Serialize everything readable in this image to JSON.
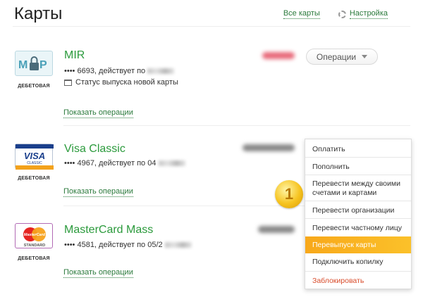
{
  "header": {
    "title": "Карты",
    "all_cards_link": "Все карты",
    "settings_link": "Настройка"
  },
  "cards": [
    {
      "name": "MIR",
      "type_label": "ДЕБЕТОВАЯ",
      "number_line": "•••• 6693, действует по",
      "status": "Статус выпуска новой карты",
      "show_ops": "Показать операции",
      "logo_text": "MIR",
      "amount_color": "#e86a7a"
    },
    {
      "name": "Visa Classic",
      "type_label": "ДЕБЕТОВАЯ",
      "number_line": "•••• 4967, действует по 04",
      "show_ops": "Показать операции",
      "logo_text": "VISA",
      "logo_subtext": "CLASSIC",
      "amount_color": "#777777"
    },
    {
      "name": "MasterCard Mass",
      "type_label": "ДЕБЕТОВАЯ",
      "number_line": "•••• 4581, действует по 05/2",
      "show_ops": "Показать операции",
      "logo_text": "MasterCard",
      "logo_subtext": "STANDARD",
      "amount_color": "#777777"
    }
  ],
  "operations_button": "Операции",
  "coin_label": "1",
  "dropdown": {
    "items": [
      "Оплатить",
      "Пополнить",
      "Перевести между своими счетами и картами",
      "Перевести организации",
      "Перевести частному лицу",
      "Перевыпуск карты",
      "Подключить копилку",
      "Заблокировать"
    ],
    "active_index": 5,
    "danger_index": 7
  },
  "colors": {
    "accent_green": "#2b9a3c",
    "link_green": "#2b7a3c",
    "active_orange": "#f8a81a",
    "danger_red": "#d84b2a"
  }
}
